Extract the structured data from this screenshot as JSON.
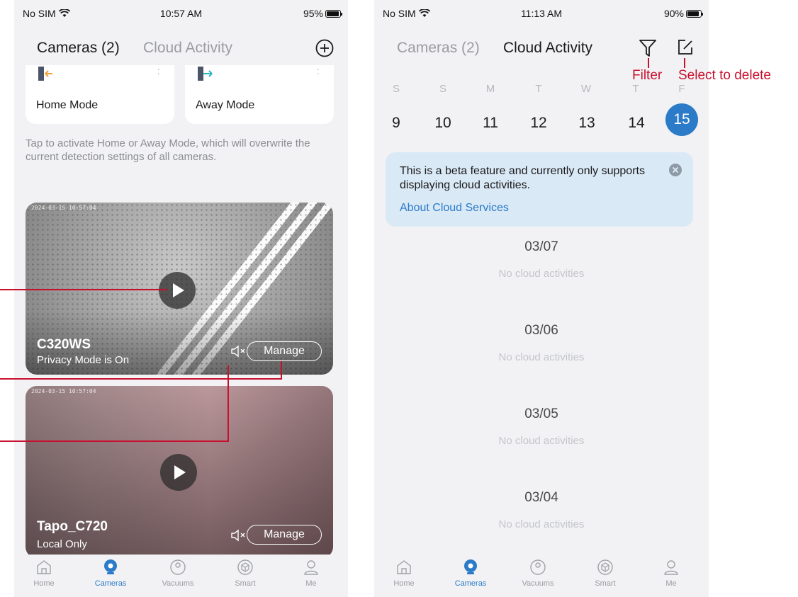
{
  "left_screen": {
    "status": {
      "carrier": "No SIM",
      "time": "10:57 AM",
      "battery": "95%",
      "battery_level": 0.95
    },
    "tabs": {
      "cameras": "Cameras (2)",
      "cloud": "Cloud Activity"
    },
    "modes": [
      {
        "label": "Home Mode",
        "icon": "home-mode-icon"
      },
      {
        "label": "Away Mode",
        "icon": "away-mode-icon"
      }
    ],
    "hint": "Tap to activate Home or Away Mode, which will overwrite the current detection settings of all cameras.",
    "cameras": [
      {
        "name": "C320WS",
        "status": "Privacy Mode is On",
        "manage": "Manage",
        "timestamp": "2024-03-15 10:57:04"
      },
      {
        "name": "Tapo_C720",
        "status": "Local Only",
        "manage": "Manage",
        "timestamp": "2024-03-15 10:57:04"
      }
    ]
  },
  "right_screen": {
    "status": {
      "carrier": "No SIM",
      "time": "11:13 AM",
      "battery": "90%",
      "battery_level": 0.9
    },
    "tabs": {
      "cameras": "Cameras (2)",
      "cloud": "Cloud Activity"
    },
    "weekdays": [
      "S",
      "S",
      "M",
      "T",
      "W",
      "T",
      "F"
    ],
    "days": [
      "9",
      "10",
      "11",
      "12",
      "13",
      "14",
      "15"
    ],
    "selected_day": "15",
    "beta": {
      "text": "This is a beta feature and currently only supports displaying cloud activities.",
      "link": "About Cloud Services"
    },
    "groups": [
      {
        "date": "03/07",
        "note": "No cloud activities"
      },
      {
        "date": "03/06",
        "note": "No cloud activities"
      },
      {
        "date": "03/05",
        "note": "No cloud activities"
      },
      {
        "date": "03/04",
        "note": "No cloud activities"
      }
    ]
  },
  "tabbar": [
    "Home",
    "Cameras",
    "Vacuums",
    "Smart",
    "Me"
  ],
  "annotations": {
    "filter": "Filter",
    "select_delete": "Select to delete"
  },
  "colors": {
    "accent": "#2b7bc9",
    "annotation": "#c8102e",
    "background": "#f2f2f4"
  }
}
